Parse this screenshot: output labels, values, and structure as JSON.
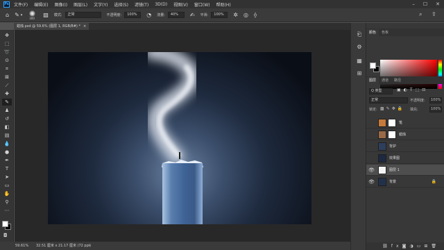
{
  "menubar": {
    "logo": "Ps",
    "items": [
      "文件(F)",
      "编辑(E)",
      "图像(I)",
      "图层(L)",
      "文字(Y)",
      "选择(S)",
      "滤镜(T)",
      "3D(D)",
      "视图(V)",
      "窗口(W)",
      "帮助(H)"
    ],
    "window_controls": [
      "–",
      "☐",
      "✕"
    ]
  },
  "options": {
    "brush_size": "300",
    "mode_label": "模式:",
    "mode_value": "正常",
    "opacity_label": "不透明度:",
    "opacity_value": "100%",
    "flow_label": "流量:",
    "flow_value": "40%",
    "smooth_label": "平滑:",
    "smooth_value": "100%"
  },
  "document": {
    "tab_title": "蜡烛.psd @ 59.6% (图层 1, RGB/8#) *",
    "close": "×"
  },
  "status": {
    "zoom": "59.61%",
    "doc_size": "32.51 厘米 x 21.17 厘米 (72 ppi)",
    "arrow": "›"
  },
  "panels": {
    "color_tabs": [
      "颜色",
      "色板"
    ],
    "layer_tabs": [
      "图层",
      "通道",
      "路径"
    ],
    "filter_value": "Q 类型",
    "blend_mode": "正常",
    "opacity_label": "不透明度:",
    "opacity_value": "100%",
    "lock_label": "锁定:",
    "fill_label": "填充:",
    "fill_value": "100%"
  },
  "layers": [
    {
      "name": "笔",
      "visible": false,
      "selected": false,
      "thumb": "#c47a3c"
    },
    {
      "name": "蜡烛",
      "visible": false,
      "selected": false,
      "thumb": "#9a6a48"
    },
    {
      "name": "背护",
      "visible": false,
      "selected": false,
      "thumb": "#2e3f5c"
    },
    {
      "name": "效果图",
      "visible": false,
      "selected": false,
      "thumb": "#1d2940"
    },
    {
      "name": "图层 1",
      "visible": true,
      "selected": true,
      "thumb": "#f4f4f4"
    },
    {
      "name": "背景",
      "visible": true,
      "selected": false,
      "thumb": "#22314a",
      "locked": true
    }
  ],
  "colors": {
    "foreground": "#ffffff",
    "background": "#000000",
    "accent": "#31a8ff"
  }
}
